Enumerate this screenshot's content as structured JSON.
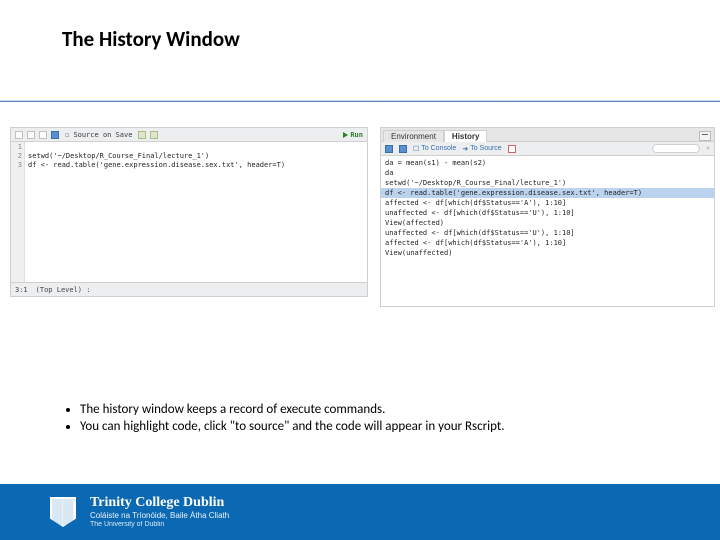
{
  "title": "The History Window",
  "editor": {
    "toolbar": {
      "sourceOnSave": "Source on Save",
      "run": "Run"
    },
    "gutter": [
      "1",
      "2",
      "3"
    ],
    "lines": [
      {
        "plain": "setwd('~/Desktop/R_Course_Final/lecture_1')"
      },
      {
        "plain": "df <- read.table('gene.expression.disease.sex.txt', header=T)"
      },
      {
        "plain": " "
      }
    ],
    "status": {
      "pos": "3:1",
      "scope": "(Top Level) :"
    }
  },
  "history": {
    "tabs": {
      "env": "Environment",
      "hist": "History"
    },
    "tools": {
      "toConsole": "To Console",
      "toSource": "To Source"
    },
    "lines": [
      "da = mean(s1) - mean(s2)",
      "da",
      "setwd('~/Desktop/R_Course_Final/lecture_1')",
      "df <- read.table('gene.expression.disease.sex.txt', header=T)",
      "affected <- df[which(df$Status=='A'), 1:10]",
      "unaffected <- df[which(df$Status=='U'), 1:10]",
      "View(affected)",
      "unaffected <- df[which(df$Status=='U'), 1:10]",
      "affected <- df[which(df$Status=='A'), 1:10]",
      "View(unaffected)"
    ],
    "selectedIndex": 3
  },
  "bullets": [
    "The history window keeps a record of execute commands.",
    "You can highlight code, click \"to source\" and the code will appear in your Rscript."
  ],
  "footer": {
    "name": "Trinity College Dublin",
    "gaelic": "Coláiste na Tríonóide, Baile Átha Cliath",
    "sub": "The University of Dublin"
  }
}
